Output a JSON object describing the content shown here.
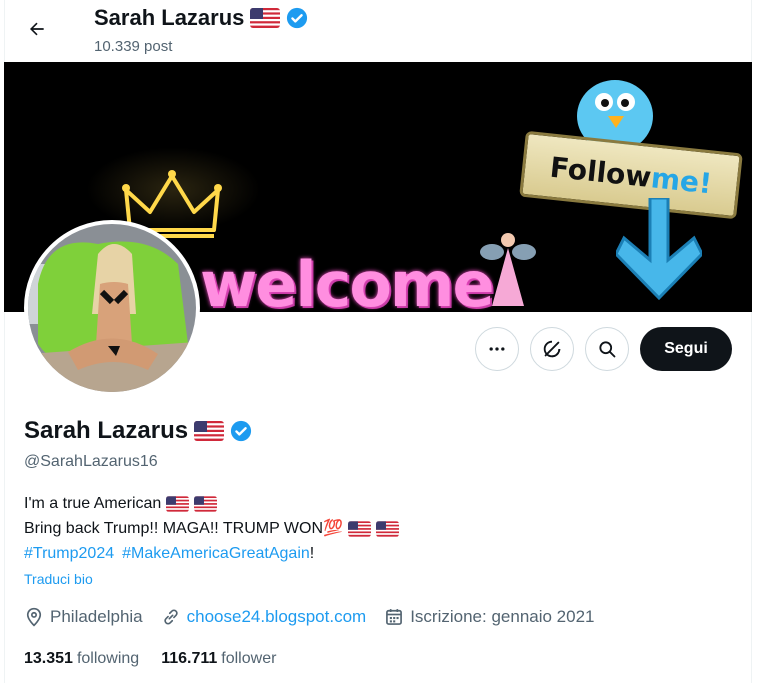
{
  "header": {
    "name": "Sarah Lazarus",
    "posts": "10.339 post"
  },
  "banner": {
    "welcome_text": "welcome",
    "sign_text_follow": "Follow",
    "sign_text_me": "me!"
  },
  "actions": {
    "follow_label": "Segui"
  },
  "profile": {
    "name": "Sarah Lazarus",
    "handle": "@SarahLazarus16",
    "bio_line1": "I'm a true American",
    "bio_line2": "Bring back Trump!! MAGA!! TRUMP WON",
    "bio_emoji_100": "💯",
    "hashtag1": "#Trump2024",
    "hashtag2": "#MakeAmericaGreatAgain",
    "bio_line3_end": "!",
    "translate_label": "Traduci bio",
    "location": "Philadelphia",
    "website": "choose24.blogspot.com",
    "joined": "Iscrizione: gennaio 2021",
    "following_count": "13.351",
    "following_label": "following",
    "followers_count": "116.711",
    "followers_label": "follower"
  },
  "colors": {
    "accent": "#1d9bf0",
    "text": "#0f1419",
    "muted": "#536471",
    "verified": "#1d9bf0"
  },
  "icons": [
    "back-arrow-icon",
    "us-flag-icon",
    "verified-badge-icon",
    "more-icon",
    "notifications-off-icon",
    "search-icon",
    "location-pin-icon",
    "link-icon",
    "calendar-icon"
  ]
}
